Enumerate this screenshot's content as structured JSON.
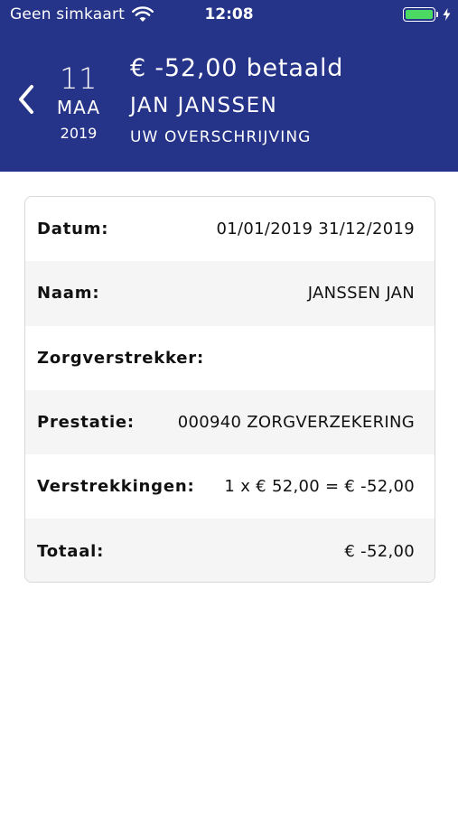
{
  "status_bar": {
    "carrier": "Geen simkaart",
    "time": "12:08",
    "battery_level": 1.0,
    "battery_color": "#4cd964"
  },
  "header": {
    "background_color": "#253388",
    "back_icon": "chevron-left-icon",
    "date": {
      "day": "11",
      "month": "MAA",
      "year": "2019"
    },
    "amount": "€ -52,00 betaald",
    "name": "JAN JANSSEN",
    "type": "UW OVERSCHRIJVING"
  },
  "details": {
    "rows": [
      {
        "label": "Datum:",
        "value": "01/01/2019 31/12/2019"
      },
      {
        "label": "Naam:",
        "value": "JANSSEN JAN"
      },
      {
        "label": "Zorgverstrekker:",
        "value": ""
      },
      {
        "label": "Prestatie:",
        "value": "000940 ZORGVERZEKERING"
      },
      {
        "label": "Verstrekkingen:",
        "value": "1 x € 52,00 = € -52,00"
      },
      {
        "label": "Totaal:",
        "value": "€ -52,00"
      }
    ]
  }
}
